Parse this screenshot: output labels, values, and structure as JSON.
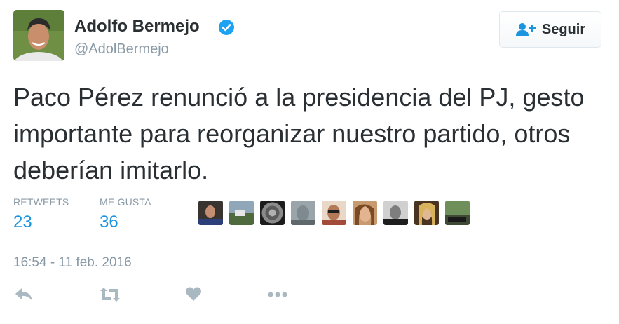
{
  "author": {
    "name": "Adolfo Bermejo",
    "handle": "@AdolBermejo",
    "verified": true,
    "avatar_icon": "profile-photo"
  },
  "follow_button": {
    "label": "Seguir",
    "icon": "add-user-icon"
  },
  "tweet": {
    "text": "Paco Pérez renunció a la presidencia del PJ, gesto importante para reorganizar nuestro partido, otros deberían imitarlo.",
    "timestamp": "16:54 - 11 feb. 2016"
  },
  "stats": {
    "retweets_label": "RETWEETS",
    "retweets_count": "23",
    "likes_label": "ME GUSTA",
    "likes_count": "36"
  },
  "likers": [
    {
      "icon": "liker-avatar"
    },
    {
      "icon": "liker-avatar"
    },
    {
      "icon": "liker-avatar"
    },
    {
      "icon": "liker-avatar"
    },
    {
      "icon": "liker-avatar"
    },
    {
      "icon": "liker-avatar"
    },
    {
      "icon": "liker-avatar"
    },
    {
      "icon": "liker-avatar"
    },
    {
      "icon": "liker-avatar"
    }
  ],
  "actions": [
    "reply-icon",
    "retweet-icon",
    "like-icon",
    "more-icon"
  ],
  "colors": {
    "text": "#292f33",
    "muted": "#8899a6",
    "link": "#1b95e0",
    "verified": "#1da1f2",
    "action_icon": "#aab8c2",
    "border": "#e1e8ed"
  }
}
